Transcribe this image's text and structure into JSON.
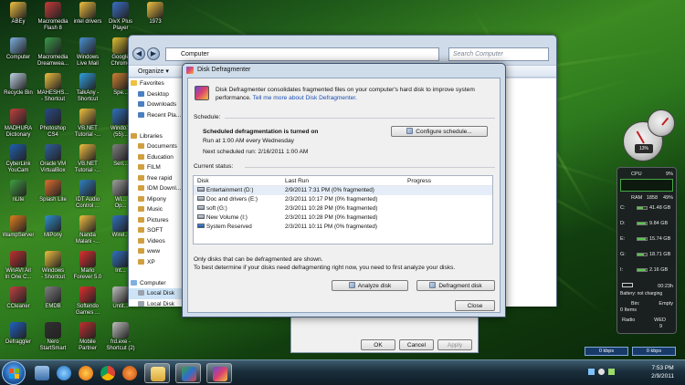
{
  "desktop_icons": [
    {
      "label": "ABEy",
      "color": "#f0c040"
    },
    {
      "label": "Macromedia\nFlash 8",
      "color": "#c83a3a"
    },
    {
      "label": "intel drivers",
      "color": "#f0c040"
    },
    {
      "label": "DivX Plus\nPlayer",
      "color": "#3a6fc8"
    },
    {
      "label": "1973",
      "color": "#f0c040"
    },
    {
      "label": "Computer",
      "color": "#7fb0e0"
    },
    {
      "label": "Macromedia\nDreamwea...",
      "color": "#3a9a4a"
    },
    {
      "label": "Windows\nLive Mail",
      "color": "#4a90d0"
    },
    {
      "label": "Google\nChrome",
      "color": "#e0c030"
    },
    {
      "label": "Recycle Bin",
      "color": "#c0d4e6"
    },
    {
      "label": "MAHESHS...\n- Shortcut",
      "color": "#f0c040"
    },
    {
      "label": "TalkAny -\nShortcut",
      "color": "#30a0e0"
    },
    {
      "label": "Spe...",
      "color": "#d08030"
    },
    {
      "label": "MADHURA\nDictionary",
      "color": "#c04040"
    },
    {
      "label": "Photoshop\nCS4",
      "color": "#2a4a8a"
    },
    {
      "label": "VB.NET\nTutorial -...",
      "color": "#f0c040"
    },
    {
      "label": "Windo...\n(55)...",
      "color": "#3070c0"
    },
    {
      "label": "CyberLink\nYouCam",
      "color": "#2060b0"
    },
    {
      "label": "Oracle VM\nVirtualBox",
      "color": "#3060a0"
    },
    {
      "label": "VB.NET\nTutorial -...",
      "color": "#f0c040"
    },
    {
      "label": "Seri...",
      "color": "#808080"
    },
    {
      "label": "nLite",
      "color": "#40a040"
    },
    {
      "label": "Splash Lite",
      "color": "#e07030"
    },
    {
      "label": "IDT Audio\nControl ...",
      "color": "#3080c0"
    },
    {
      "label": "Wi...\nOp...",
      "color": "#a0a0a0"
    },
    {
      "label": "WampServer",
      "color": "#e08020"
    },
    {
      "label": "MiPony",
      "color": "#3090d0"
    },
    {
      "label": "Nanda\nMalani -...",
      "color": "#f0c040"
    },
    {
      "label": "Wirel...",
      "color": "#3070c0"
    },
    {
      "label": "WinAVI All\nIn One C...",
      "color": "#c03030"
    },
    {
      "label": "Windows\n- Shortcut",
      "color": "#f0c040"
    },
    {
      "label": "Mario\nForever 5.0",
      "color": "#e03030"
    },
    {
      "label": "Int...",
      "color": "#3070c0"
    },
    {
      "label": "CCleaner",
      "color": "#c04040"
    },
    {
      "label": "EMDB",
      "color": "#808080"
    },
    {
      "label": "Softendo\nGames ...",
      "color": "#e03030"
    },
    {
      "label": "Untit...",
      "color": "#c0c0c0"
    },
    {
      "label": "Defraggler",
      "color": "#2060c0"
    },
    {
      "label": "Nero\nStartSmart",
      "color": "#303030"
    },
    {
      "label": "Mobile\nPartner",
      "color": "#c03030"
    },
    {
      "label": "frd.exe -\nShortcut (2)",
      "color": "#c0c0c0"
    }
  ],
  "explorer": {
    "address": "Computer",
    "search_placeholder": "Search Computer",
    "organize_label": "Organize ▾",
    "nav_items": [
      {
        "label": "Favorites",
        "color": "#f0c040",
        "header": true
      },
      {
        "label": "Desktop",
        "color": "#4a7fc0"
      },
      {
        "label": "Downloads",
        "color": "#4a7fc0"
      },
      {
        "label": "Recent Pla...",
        "color": "#4a7fc0"
      },
      {
        "label": "",
        "color": ""
      },
      {
        "label": "Libraries",
        "color": "#d0a040",
        "header": true
      },
      {
        "label": "Documents",
        "color": "#d0a040"
      },
      {
        "label": "Education",
        "color": "#d0a040"
      },
      {
        "label": "FILM",
        "color": "#d0a040"
      },
      {
        "label": "free rapid",
        "color": "#d0a040"
      },
      {
        "label": "IDM Downl...",
        "color": "#d0a040"
      },
      {
        "label": "Mipony",
        "color": "#d0a040"
      },
      {
        "label": "Music",
        "color": "#d0a040"
      },
      {
        "label": "Pictures",
        "color": "#d0a040"
      },
      {
        "label": "SOFT",
        "color": "#d0a040"
      },
      {
        "label": "Videos",
        "color": "#d0a040"
      },
      {
        "label": "www",
        "color": "#d0a040"
      },
      {
        "label": "XP",
        "color": "#d0a040"
      },
      {
        "label": "",
        "color": ""
      },
      {
        "label": "Computer",
        "color": "#7fb0e0",
        "header": true
      },
      {
        "label": "Local Disk",
        "color": "#9aa2ad"
      },
      {
        "label": "Local Disk",
        "color": "#9aa2ad"
      }
    ],
    "sub_dialog": {
      "ok": "OK",
      "cancel": "Cancel",
      "apply": "Apply"
    }
  },
  "defrag": {
    "title": "Disk Defragmenter",
    "intro": "Disk Defragmenter consolidates fragmented files on your computer's hard disk to improve system performance.",
    "intro_link": "Tell me more about Disk Defragmenter.",
    "schedule_label": "Schedule:",
    "schedule_status": "Scheduled defragmentation is turned on",
    "schedule_run": "Run at 1:00 AM every Wednesday",
    "schedule_next": "Next scheduled run: 2/16/2011 1:00 AM",
    "configure_button": "Configure schedule...",
    "current_status_label": "Current status:",
    "columns": [
      "Disk",
      "Last Run",
      "Progress"
    ],
    "disks": [
      {
        "name": "Entertainment (D:)",
        "last_run": "2/9/2011 7:31 PM (0% fragmented)",
        "progress": "",
        "system": false
      },
      {
        "name": "Doc and drivers (E:)",
        "last_run": "2/3/2011 10:17 PM (0% fragmented)",
        "progress": "",
        "system": false
      },
      {
        "name": "soft (G:)",
        "last_run": "2/3/2011 10:28 PM (0% fragmented)",
        "progress": "",
        "system": false
      },
      {
        "name": "New Volume (I:)",
        "last_run": "2/3/2011 10:28 PM (0% fragmented)",
        "progress": "",
        "system": false
      },
      {
        "name": "System Reserved",
        "last_run": "2/3/2011 10:11 PM (0% fragmented)",
        "progress": "",
        "system": true
      }
    ],
    "note1": "Only disks that can be defragmented are shown.",
    "note2": "To best determine if your disks need defragmenting right now, you need to first analyze your disks.",
    "analyze_button": "Analyze disk",
    "defragment_button": "Defragment disk",
    "close_button": "Close"
  },
  "gadgets": {
    "cpu_label": "CPU",
    "cpu_value": "9%",
    "ram_label": "RAM",
    "ram_value": "1858",
    "ram_pct": "49%",
    "drives": [
      {
        "letter": "C:",
        "value": "41.48 GB",
        "pct": "57%"
      },
      {
        "letter": "D:",
        "value": "9.84 GB",
        "pct": "88%"
      },
      {
        "letter": "E:",
        "value": "15.74 GB",
        "pct": "88%"
      },
      {
        "letter": "G:",
        "value": "18.71 GB",
        "pct": "72%"
      },
      {
        "letter": "I:",
        "value": "2.16 GB",
        "pct": "88%"
      }
    ],
    "battery_time": "00:23h",
    "battery_status": "Battery: not charging",
    "bin_label": "Bin:",
    "bin_value": "0 Items",
    "empty_label": "Empty",
    "radio_label": "Radio",
    "day_label": "WED",
    "day_number": "9",
    "gauge_value": "13%",
    "net_down": "0 kbps",
    "net_up": "0 kbps"
  },
  "taskbar": {
    "time": "7:53 PM",
    "date": "2/9/2011"
  }
}
